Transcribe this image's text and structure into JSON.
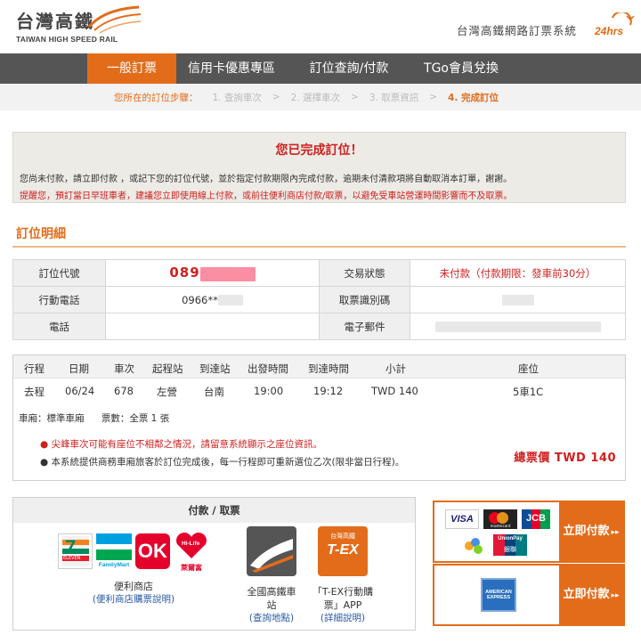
{
  "header": {
    "logo_cn": "台灣高鐵",
    "logo_en": "TAIWAN HIGH SPEED RAIL",
    "system_title": "台灣高鐵網路訂票系統",
    "badge_24": "24hrs"
  },
  "nav": {
    "items": [
      {
        "label": "一般訂票",
        "active": true
      },
      {
        "label": "信用卡優惠專區",
        "active": false
      },
      {
        "label": "訂位查詢/付款",
        "active": false
      },
      {
        "label": "TGo會員兌換",
        "active": false
      }
    ]
  },
  "steps": {
    "lead": "您所在的訂位步驟：",
    "items": [
      "1. 查詢車次",
      "2. 選擇車次",
      "3. 取票資訊",
      "4. 完成訂位"
    ],
    "separator": ">"
  },
  "notice": {
    "title": "您已完成訂位！",
    "line1": "您尚未付款，請立即付款 ，或記下您的訂位代號，並於指定付款期限內完成付款，逾期未付清款項將自動取消本訂單，謝謝。",
    "line2": "提醒您，預訂當日早班車者，建議您立即使用線上付款，或前往便利商店付款/取票，以避免受車站營運時間影響而不及取票。"
  },
  "booking": {
    "section_title": "訂位明細",
    "code_label": "訂位代號",
    "code_value": "089",
    "status_label": "交易狀態",
    "status_value": "未付款（付款期限：發車前30分）",
    "mobile_label": "行動電話",
    "mobile_value": "0966**",
    "pickup_label": "取票識別碼",
    "phone_label": "電話",
    "email_label": "電子郵件"
  },
  "trip": {
    "headers": [
      "行程",
      "日期",
      "車次",
      "起程站",
      "到達站",
      "出發時間",
      "到達時間",
      "小計",
      "座位"
    ],
    "row": [
      "去程",
      "06/24",
      "678",
      "左營",
      "台南",
      "19:00",
      "19:12",
      "TWD 140",
      "5車1C"
    ],
    "car_type": "車廂：標準車廂",
    "ticket_count": "票數：全票 1 張",
    "note1": "尖峰車次可能有座位不相鄰之情況，請留意系統顯示之座位資訊。",
    "note2": "本系統提供商務車廂旅客於訂位完成後，每一行程即可重新選位乙次(限非當日行程)。",
    "total": "總票價 TWD 140"
  },
  "payment": {
    "title": "付款 / 取票",
    "store_name": "便利商店",
    "store_link": "(便利商店購票說明)",
    "station_name_1": "全國高鐵車",
    "station_name_2": "站",
    "station_link": "(查詢地點)",
    "tex_name_1": "「T-EX行動購",
    "tex_name_2": "票」APP",
    "tex_link": "(詳細說明)",
    "tex_logo_top": "台灣高鐵",
    "tex_logo_text": "T-EX",
    "seven_text": "ELEVEN",
    "familymart_text": "FamilyMart",
    "ok_text": "OK",
    "hilife_text": "Hi-Life",
    "hilife_sub": "萊爾富"
  },
  "paynow": {
    "button_label": "立即付款",
    "arrow": "▸▸",
    "visa": "VISA",
    "mastercard": "mastercard",
    "jcb": "JCB",
    "unionpay": "UnionPay",
    "unionpay_cn": "銀聯",
    "amex_line1": "AMERICAN",
    "amex_line2": "EXPRESS"
  },
  "colors": {
    "accent": "#e36c1a",
    "nav_bg": "#555555",
    "alert_red": "#d0201f",
    "link_blue": "#2a5aa5"
  }
}
